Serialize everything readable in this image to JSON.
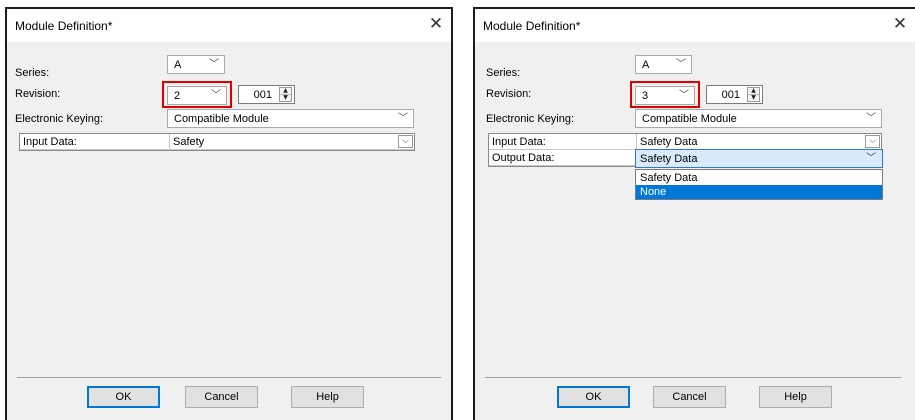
{
  "left": {
    "title": "Module Definition*",
    "close": "✕",
    "series_label": "Series:",
    "series_value": "A",
    "revision_label": "Revision:",
    "revision_major": "2",
    "revision_minor": "001",
    "keying_label": "Electronic Keying:",
    "keying_value": "Compatible Module",
    "rows": [
      {
        "label": "Input Data:",
        "value": "Safety"
      }
    ],
    "buttons": {
      "ok": "OK",
      "cancel": "Cancel",
      "help": "Help"
    }
  },
  "right": {
    "title": "Module Definition*",
    "close": "✕",
    "series_label": "Series:",
    "series_value": "A",
    "revision_label": "Revision:",
    "revision_major": "3",
    "revision_minor": "001",
    "keying_label": "Electronic Keying:",
    "keying_value": "Compatible Module",
    "rows": [
      {
        "label": "Input Data:",
        "value": "Safety Data"
      },
      {
        "label": "Output Data:",
        "value": "Safety Data"
      }
    ],
    "dropdown_options": [
      "Safety Data",
      "None"
    ],
    "dropdown_selected_index": 1,
    "buttons": {
      "ok": "OK",
      "cancel": "Cancel",
      "help": "Help"
    }
  },
  "glyphs": {
    "chevron": "﹀",
    "spin_up": "▲",
    "spin_down": "▼",
    "grid_drop": "⌵"
  },
  "colors": {
    "highlight_border": "#e00000",
    "selection": "#0078d7",
    "focus_border": "#2a7ad6"
  }
}
